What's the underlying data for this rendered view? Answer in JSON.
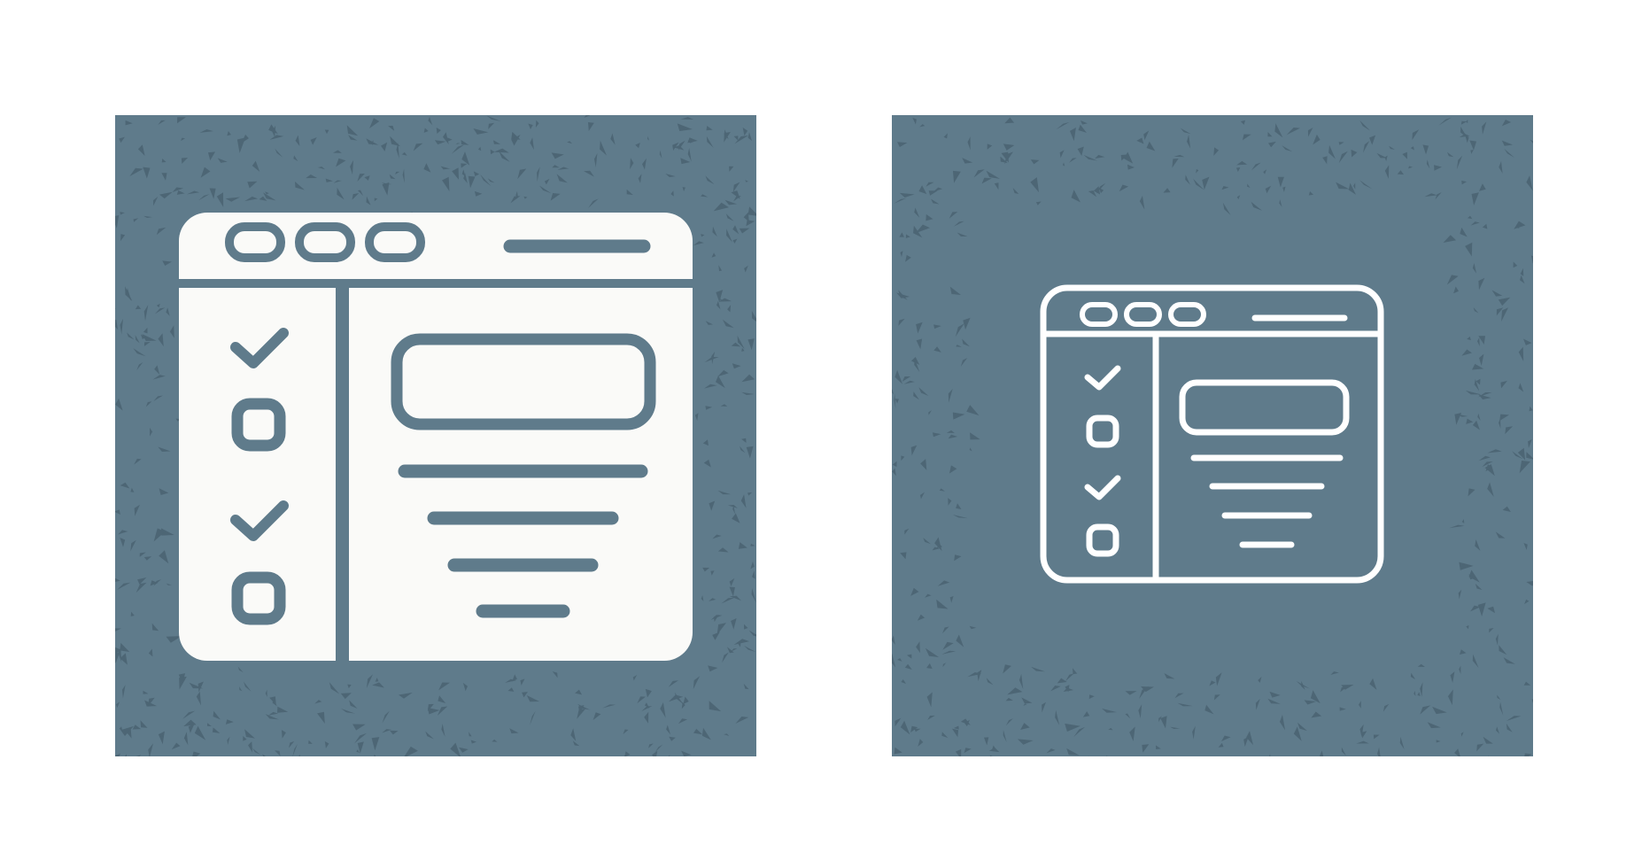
{
  "colors": {
    "page_background": "#ffffff",
    "tile_background": "#5f7b8b",
    "texture_speckle": "#4d6675",
    "icon_fill": "#fafaf8",
    "icon_detail": "#5f7b8b",
    "outline_stroke": "#ffffff"
  },
  "icons": [
    {
      "name": "checklist-browser-window-icon",
      "style": "glyph",
      "tile_texture": "full",
      "sidebar_items": [
        "check",
        "empty-box",
        "check",
        "empty-box"
      ],
      "window_dots": 3,
      "content_lines": 4
    },
    {
      "name": "checklist-browser-window-icon",
      "style": "outline",
      "tile_texture": "border",
      "sidebar_items": [
        "check",
        "empty-box",
        "check",
        "empty-box"
      ],
      "window_dots": 3,
      "content_lines": 4
    }
  ]
}
